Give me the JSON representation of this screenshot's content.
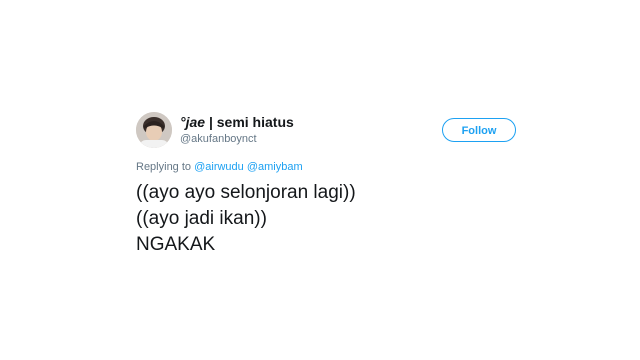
{
  "user": {
    "name_styled": "°jae",
    "name_rest": " | semi hiatus",
    "handle": "@akufanboynct"
  },
  "follow_button": {
    "label": "Follow"
  },
  "reply": {
    "prefix": "Replying to ",
    "mentions": [
      "@airwudu",
      "@amiybam"
    ]
  },
  "tweet": {
    "lines": [
      "((ayo ayo selonjoran lagi))",
      "((ayo jadi ikan))",
      "NGAKAK"
    ]
  },
  "colors": {
    "accent": "#1da1f2",
    "text": "#14171a",
    "muted": "#657786",
    "background": "#ffffff"
  }
}
